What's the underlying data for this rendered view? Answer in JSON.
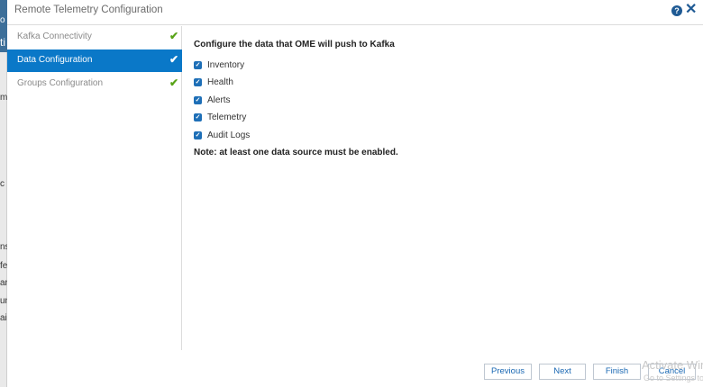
{
  "background": {
    "fragments": [
      "o",
      "ti",
      "m",
      "c",
      "ns",
      "fe",
      "ar",
      "un",
      "ai"
    ]
  },
  "dialog": {
    "title": "Remote Telemetry Configuration",
    "help_glyph": "?",
    "close_glyph": "✕"
  },
  "steps": [
    {
      "label": "Kafka Connectivity",
      "check": "✔"
    },
    {
      "label": "Data Configuration",
      "check": "✔"
    },
    {
      "label": "Groups Configuration",
      "check": "✔"
    }
  ],
  "content": {
    "heading": "Configure the data that OME will push to Kafka",
    "checkbox_glyph": "✓",
    "options": [
      {
        "label": "Inventory",
        "checked": true
      },
      {
        "label": "Health",
        "checked": true
      },
      {
        "label": "Alerts",
        "checked": true
      },
      {
        "label": "Telemetry",
        "checked": true
      },
      {
        "label": "Audit Logs",
        "checked": true
      }
    ],
    "note": "Note: at least one data source must be enabled."
  },
  "footer": {
    "previous": "Previous",
    "next": "Next",
    "finish": "Finish",
    "cancel": "Cancel"
  },
  "watermark": {
    "line1": "Activate Win",
    "line2": "Go to Settings to"
  },
  "colors": {
    "accent": "#0a78c8",
    "check_green": "#58a318",
    "icon_blue": "#1f5a94"
  }
}
